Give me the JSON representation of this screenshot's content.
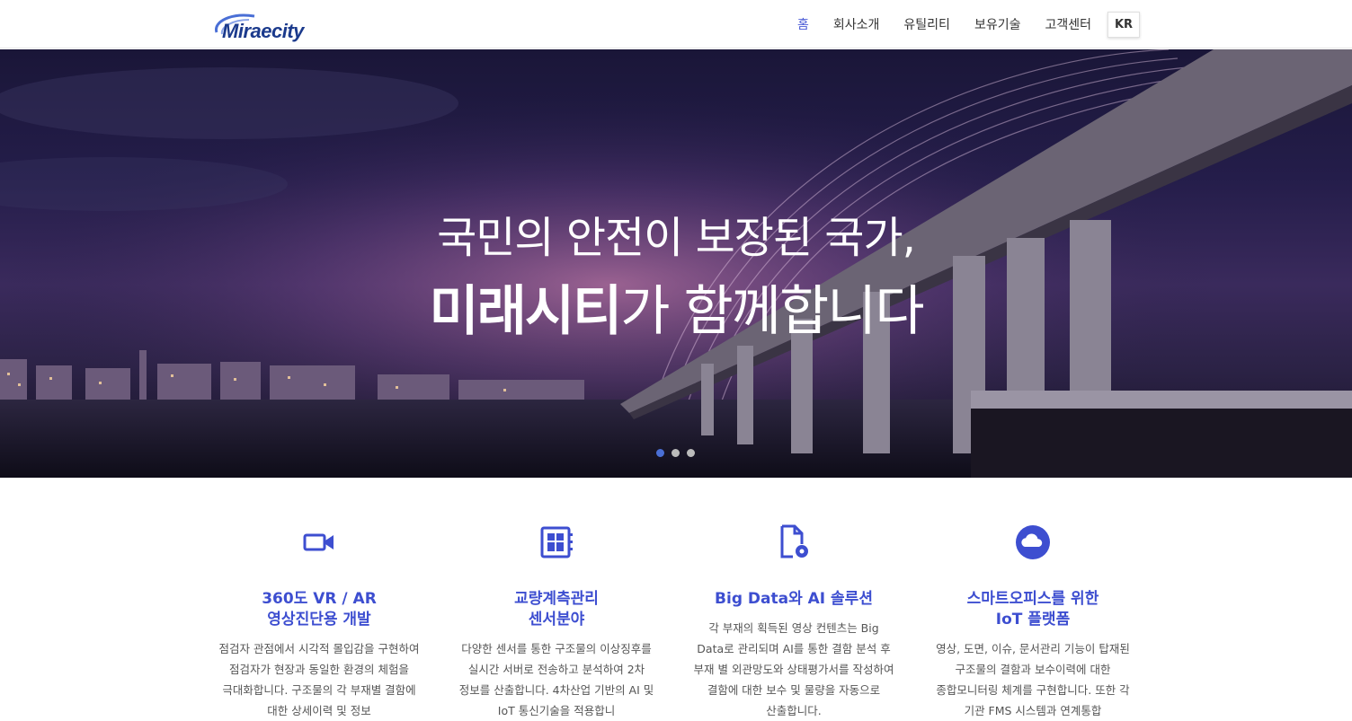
{
  "header": {
    "logo_text": "Miraecity",
    "nav": [
      {
        "label": "홈",
        "active": true
      },
      {
        "label": "회사소개"
      },
      {
        "label": "유틸리티"
      },
      {
        "label": "보유기술"
      },
      {
        "label": "고객센터"
      }
    ],
    "lang": "KR"
  },
  "hero": {
    "line1": "국민의 안전이 보장된 국가,",
    "line2_bold": "미래시티",
    "line2_rest": "가 함께합니다",
    "slides": 3,
    "active_slide": 1
  },
  "features": [
    {
      "icon": "video-camera-icon",
      "title_1": "360도 VR / AR",
      "title_2": "영상진단용 개발",
      "text": "점검자 관점에서 시각적 몰입감을 구현하여 점검자가 현장과 동일한 환경의 체험을 극대화합니다. 구조물의 각 부재별 결함에 대한 상세이력 및 정보"
    },
    {
      "icon": "sensor-board-icon",
      "title_1": "교량계측관리",
      "title_2": "센서분야",
      "text": "다양한 센서를 통한 구조물의 이상징후를 실시간 서버로 전송하고 분석하여 2차 정보를 산출합니다. 4차산업 기반의 AI 및 IoT 통신기술을 적용합니"
    },
    {
      "icon": "file-settings-icon",
      "title_1": "Big Data와 AI 솔루션",
      "title_2": "",
      "text": "각 부재의 획득된 영상 컨텐츠는 Big Data로 관리되며 AI를 통한 결함 분석 후 부재 별 외관망도와 상태평가서를 작성하여 결함에 대한 보수 및 물량을 자동으로 산출합니다."
    },
    {
      "icon": "cloud-icon",
      "title_1": "스마트오피스를 위한",
      "title_2": "IoT 플랫폼",
      "text": "영상, 도면, 이슈, 문서관리 기능이 탑재된 구조물의 결함과 보수이력에 대한 종합모니터링 체계를 구현합니다. 또한 각 기관 FMS 시스템과 연계통합"
    }
  ],
  "colors": {
    "accent": "#3d4ed0",
    "nav_active": "#4a5bd6",
    "dot_active": "#4a6fd6"
  }
}
